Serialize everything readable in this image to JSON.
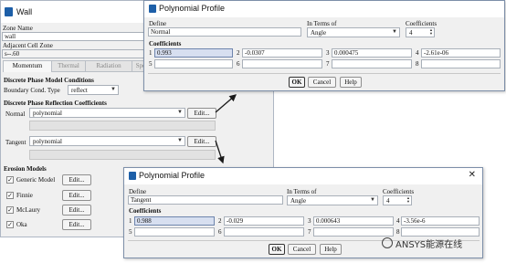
{
  "wall": {
    "title": "Wall",
    "zone_name_label": "Zone Name",
    "zone_name_value": "wall",
    "adjacent_label": "Adjacent Cell Zone",
    "adjacent_value": "s--.60",
    "tabs": [
      "Momentum",
      "Thermal",
      "Radiation",
      "Spe"
    ],
    "dpm_conditions_title": "Discrete Phase Model Conditions",
    "boundary_label": "Boundary Cond. Type",
    "boundary_value": "reflect",
    "reflection_title": "Discrete Phase Reflection Coefficients",
    "normal_label": "Normal",
    "normal_value": "polynomial",
    "tangent_label": "Tangent",
    "tangent_value": "polynomial",
    "edit_label": "Edit...",
    "erosion_title": "Erosion Models",
    "erosion_models": [
      {
        "label": "Generic Model",
        "checked": true
      },
      {
        "label": "Finnie",
        "checked": true
      },
      {
        "label": "McLaury",
        "checked": true
      },
      {
        "label": "Oka",
        "checked": true
      }
    ]
  },
  "profile_normal": {
    "title": "Polynomial Profile",
    "define_label": "Define",
    "define_value": "Normal",
    "in_terms_label": "In Terms of",
    "in_terms_value": "Angle",
    "coefficients_count_label": "Coefficients",
    "coefficients_count": "4",
    "coefficients_section": "Coefficients",
    "coefficients": [
      {
        "index": "1",
        "value": "0.993"
      },
      {
        "index": "2",
        "value": "-0.0307"
      },
      {
        "index": "3",
        "value": "0.000475"
      },
      {
        "index": "4",
        "value": "-2.61e-06"
      },
      {
        "index": "5",
        "value": ""
      },
      {
        "index": "6",
        "value": ""
      },
      {
        "index": "7",
        "value": ""
      },
      {
        "index": "8",
        "value": ""
      }
    ],
    "ok_label": "OK",
    "cancel_label": "Cancel",
    "help_label": "Help"
  },
  "profile_tangent": {
    "title": "Polynomial Profile",
    "define_label": "Define",
    "define_value": "Tangent",
    "in_terms_label": "In Terms of",
    "in_terms_value": "Angle",
    "coefficients_count_label": "Coefficients",
    "coefficients_count": "4",
    "coefficients_section": "Coefficients",
    "coefficients": [
      {
        "index": "1",
        "value": "0.988"
      },
      {
        "index": "2",
        "value": "-0.029"
      },
      {
        "index": "3",
        "value": "0.000643"
      },
      {
        "index": "4",
        "value": "-3.56e-6"
      },
      {
        "index": "5",
        "value": ""
      },
      {
        "index": "6",
        "value": ""
      },
      {
        "index": "7",
        "value": ""
      },
      {
        "index": "8",
        "value": ""
      }
    ],
    "ok_label": "OK",
    "cancel_label": "Cancel",
    "help_label": "Help"
  },
  "watermark": {
    "text": "ANSYS能源在线",
    "icon": "wechat-icon"
  },
  "colors": {
    "arrow": "#1a1a1a",
    "accent": "#1d5fa8",
    "selected_field": "#d7dff0"
  }
}
